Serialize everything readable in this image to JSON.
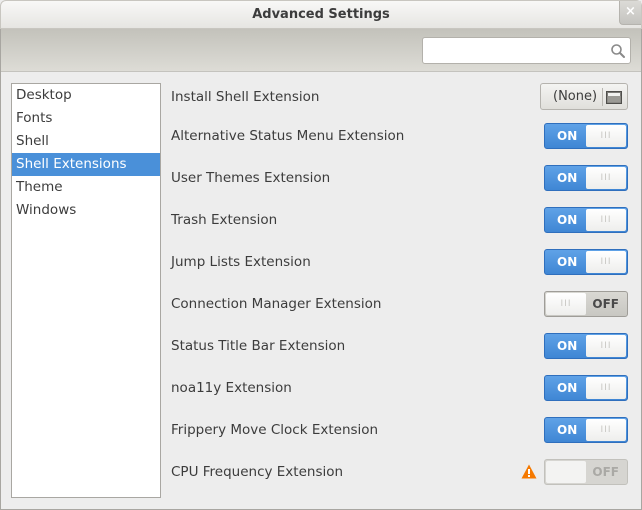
{
  "window": {
    "title": "Advanced Settings",
    "close_label": "×"
  },
  "search": {
    "value": "",
    "placeholder": ""
  },
  "sidebar": {
    "items": [
      {
        "label": "Desktop",
        "selected": false
      },
      {
        "label": "Fonts",
        "selected": false
      },
      {
        "label": "Shell",
        "selected": false
      },
      {
        "label": "Shell Extensions",
        "selected": true
      },
      {
        "label": "Theme",
        "selected": false
      },
      {
        "label": "Windows",
        "selected": false
      }
    ]
  },
  "main": {
    "install": {
      "label": "Install Shell Extension",
      "button_label": "(None)",
      "icon": "folder-icon"
    },
    "switch_labels": {
      "on": "ON",
      "off": "OFF",
      "grip": "III"
    },
    "extensions": [
      {
        "label": "Alternative Status Menu Extension",
        "state": "on"
      },
      {
        "label": "User Themes Extension",
        "state": "on"
      },
      {
        "label": "Trash Extension",
        "state": "on"
      },
      {
        "label": "Jump Lists Extension",
        "state": "on"
      },
      {
        "label": "Connection Manager Extension",
        "state": "off"
      },
      {
        "label": "Status Title Bar Extension",
        "state": "on"
      },
      {
        "label": "noa11y Extension",
        "state": "on"
      },
      {
        "label": "Frippery Move Clock Extension",
        "state": "on"
      },
      {
        "label": "CPU Frequency Extension",
        "state": "disabled",
        "warning": true
      }
    ]
  },
  "colors": {
    "accent": "#4a90d9",
    "switch_on": "#4a8fdc",
    "warning": "#f57900"
  }
}
